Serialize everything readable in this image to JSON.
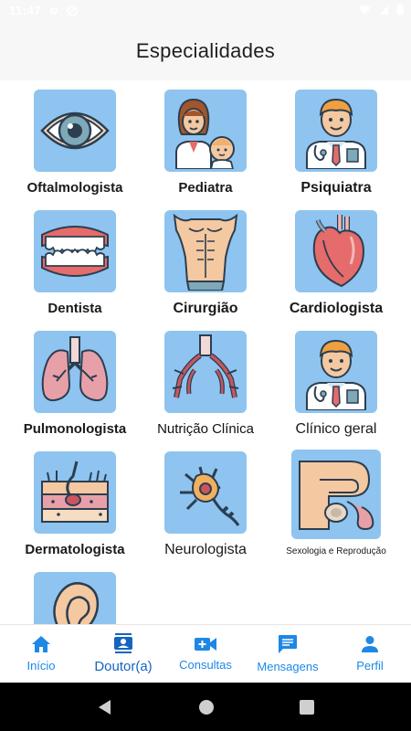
{
  "status_bar": {
    "time": "11:47"
  },
  "header": {
    "title": "Especialidades"
  },
  "specialties": [
    {
      "label": "Oftalmologista",
      "icon": "eye-icon"
    },
    {
      "label": "Pediatra",
      "icon": "pediatrician-icon"
    },
    {
      "label": "Psiquiatra",
      "icon": "doctor-icon"
    },
    {
      "label": "Dentista",
      "icon": "teeth-icon"
    },
    {
      "label": "Cirurgião",
      "icon": "torso-icon"
    },
    {
      "label": "Cardiologista",
      "icon": "heart-icon"
    },
    {
      "label": "Pulmonologista",
      "icon": "lungs-icon"
    },
    {
      "label": "Nutrição Clínica",
      "icon": "intestine-icon"
    },
    {
      "label": "Clínico geral",
      "icon": "doctor-icon"
    },
    {
      "label": "Dermatologista",
      "icon": "skin-icon"
    },
    {
      "label": "Neurologista",
      "icon": "neuron-icon"
    },
    {
      "label": "Sexologia e Reprodução",
      "icon": "reproductive-icon"
    },
    {
      "label": "",
      "icon": "ear-icon"
    }
  ],
  "bottom_nav": [
    {
      "label": "Início",
      "icon": "home-icon",
      "active": false
    },
    {
      "label": "Doutor(a)",
      "icon": "contacts-icon",
      "active": true
    },
    {
      "label": "Consultas",
      "icon": "video-call-icon",
      "active": false
    },
    {
      "label": "Mensagens",
      "icon": "message-icon",
      "active": false
    },
    {
      "label": "Perfil",
      "icon": "person-icon",
      "active": false
    }
  ],
  "colors": {
    "accent": "#1e88e5",
    "tile": "#8ec4ef",
    "header_bg": "#f7f7f7"
  }
}
